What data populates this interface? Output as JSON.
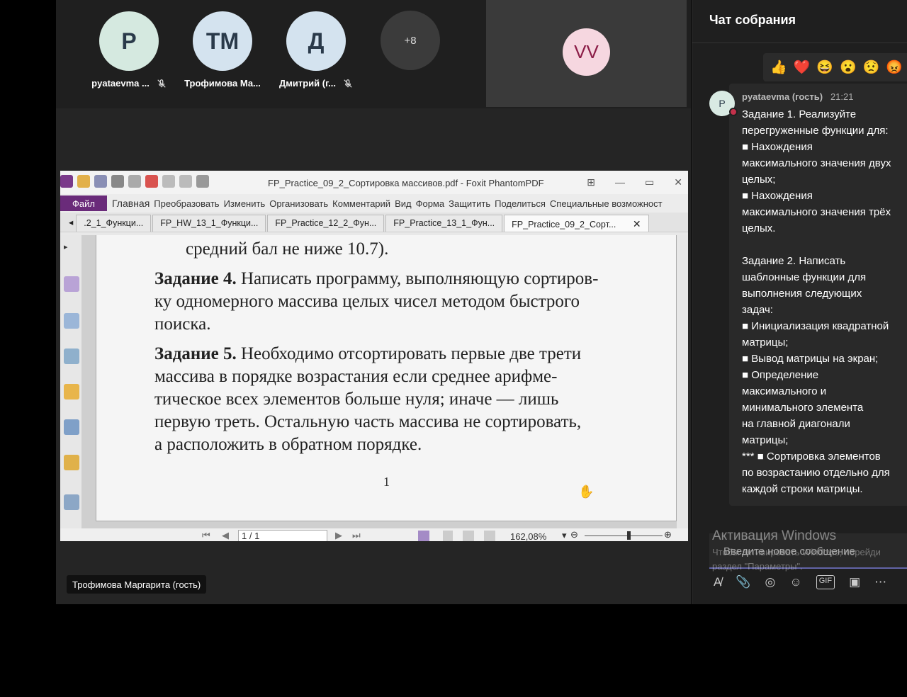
{
  "participants": [
    {
      "initials": "P",
      "name": "pyataevma ...",
      "muted": true,
      "bg": "#d5e9e0"
    },
    {
      "initials": "ТМ",
      "name": "Трофимова Ма...",
      "muted": false,
      "bg": "#d4e3ef"
    },
    {
      "initials": "Д",
      "name": "Дмитрий (г...",
      "muted": true,
      "bg": "#d4e3ef"
    }
  ],
  "more_count": "+8",
  "video_tile_initials": "VV",
  "pdf": {
    "title": "FP_Practice_09_2_Сортировка массивов.pdf - Foxit PhantomPDF",
    "file_menu": "Файл",
    "menu": [
      "Главная",
      "Преобразовать",
      "Изменить",
      "Организовать",
      "Комментарий",
      "Вид",
      "Форма",
      "Защитить",
      "Поделиться",
      "Специальные возможност"
    ],
    "tabs": [
      ".2_1_Функци...",
      "FP_HW_13_1_Функци...",
      "FP_Practice_12_2_Фун...",
      "FP_Practice_13_1_Фун...",
      "FP_Practice_09_2_Сорт..."
    ],
    "page_lines": {
      "l1": "средний бал не ниже 10.7).",
      "l2_bold": "Задание 4.",
      "l2": " Написать программу, выполняющую сортиров-",
      "l3": "ку одномерного массива целых чисел методом быстрого",
      "l4": "поиска.",
      "l5_bold": "Задание 5.",
      "l5": " Необходимо отсортировать первые две трети",
      "l6": "массива в порядке возрастания если среднее арифме-",
      "l7": "тическое всех элементов больше нуля; иначе — лишь",
      "l8": "первую треть. Остальную часть массива не сортировать,",
      "l9": "а расположить в обратном порядке."
    },
    "page_number": "1",
    "page_box": "1 / 1",
    "zoom": "162,08%"
  },
  "speaker_badge": "Трофимова Маргарита (гость)",
  "chat": {
    "title": "Чат собрания",
    "author": "pyataevma (гость)",
    "time": "21:21",
    "avatar": "P",
    "message": "Задание 1. Реализуйте\nперегруженные функции для:\n■ Нахождения\nмаксимального значения двух\nцелых;\n■ Нахождения\nмаксимального значения трёх\nцелых.\n\nЗадание 2. Написать\nшаблонные функции для\nвыполнения следующих\nзадач:\n■ Инициализация квадратной\nматрицы;\n■ Вывод матрицы на экран;\n■ Определение\nмаксимального и\nминимального элемента\nна главной диагонали\nматрицы;\n*** ■ Сортировка элементов\nпо возрастанию отдельно для\nкаждой строки матрицы.",
    "compose_placeholder": "Введите новое сообщение",
    "reactions": [
      "👍",
      "❤️",
      "😆",
      "😮",
      "😟",
      "😡"
    ]
  },
  "watermark": {
    "title": "Активация Windows",
    "line1": "Чтобы активировать Windows, перейди",
    "line2": "раздел \"Параметры\"."
  }
}
